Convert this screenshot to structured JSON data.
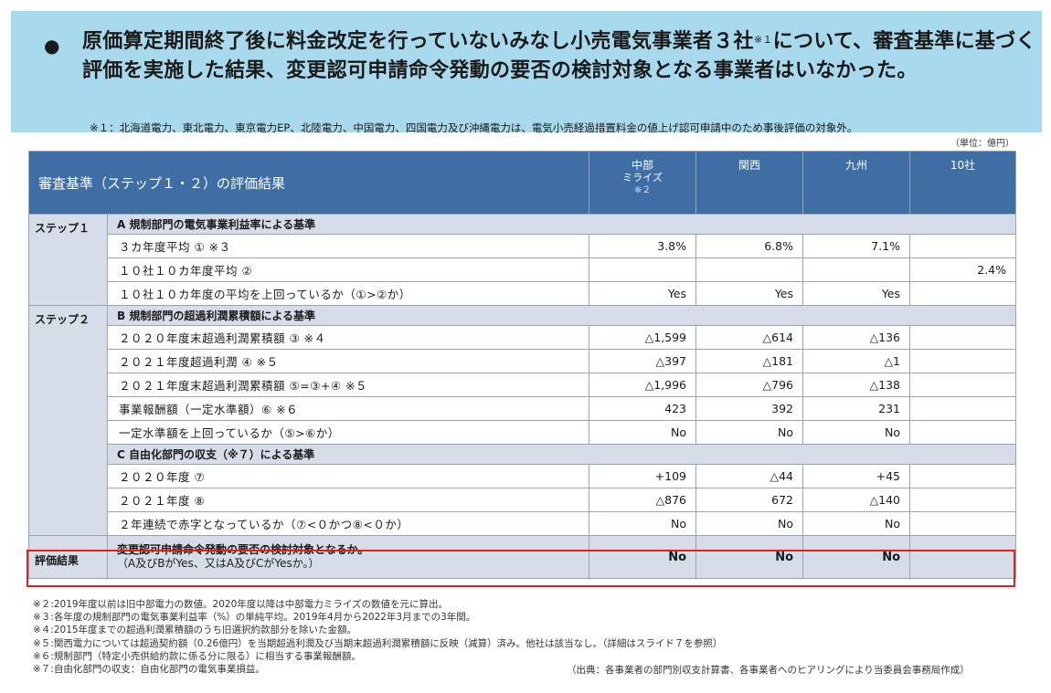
{
  "banner": {
    "bullet": "●",
    "headline_pre": "原価算定期間終了後に料金改定を行っていないみなし小売電気事業者３社",
    "headline_sup": "※１",
    "headline_post": "について、審査基準に基づく評価を実施した結果、変更認可申請命令発動の要否の検討対象となる事業者はいなかった。",
    "note": "※１：北海道電力、東北電力、東京電力EP、北陸電力、中国電力、四国電力及び沖縄電力は、電気小売経過措置料金の値上げ認可申請中のため事後評価の対象外。"
  },
  "unit": "（単位：億円）",
  "table": {
    "title": "審査基準（ステップ１・２）の評価結果",
    "columns": [
      {
        "name": "中部",
        "sub": "ミライズ",
        "note": "※２"
      },
      {
        "name": "関西",
        "sub": "",
        "note": ""
      },
      {
        "name": "九州",
        "sub": "",
        "note": ""
      },
      {
        "name": "10社",
        "sub": "",
        "note": ""
      }
    ],
    "step1_label": "ステップ１",
    "step2_label": "ステップ２",
    "secA": "A  規制部門の電気事業利益率による基準",
    "secB": "B  規制部門の超過利潤累積額による基準",
    "secC": "C  自由化部門の収支（※７）による基準",
    "rowsA": [
      {
        "label": "３カ年度平均 ①  ※３",
        "v": [
          "3.8%",
          "6.8%",
          "7.1%",
          ""
        ]
      },
      {
        "label": "１０社１０カ年度平均 ②",
        "v": [
          "",
          "",
          "",
          "2.4%"
        ]
      },
      {
        "label": "１０社１０カ年度の平均を上回っているか（①>②か）",
        "v": [
          "Yes",
          "Yes",
          "Yes",
          ""
        ]
      }
    ],
    "rowsB": [
      {
        "label": "２０２０年度末超過利潤累積額 ③  ※４",
        "v": [
          "△1,599",
          "△614",
          "△136",
          ""
        ]
      },
      {
        "label": "２０２１年度超過利潤 ④  ※５",
        "v": [
          "△397",
          "△181",
          "△1",
          ""
        ]
      },
      {
        "label": "２０２１年度末超過利潤累積額 ⑤=③+④  ※５",
        "v": [
          "△1,996",
          "△796",
          "△138",
          ""
        ]
      },
      {
        "label": "事業報酬額（一定水準額）⑥  ※６",
        "v": [
          "423",
          "392",
          "231",
          ""
        ]
      },
      {
        "label": "一定水準額を上回っているか（⑤>⑥か）",
        "v": [
          "No",
          "No",
          "No",
          ""
        ]
      }
    ],
    "rowsC": [
      {
        "label": "２０２０年度 ⑦",
        "v": [
          "+109",
          "△44",
          "+45",
          ""
        ]
      },
      {
        "label": "２０２１年度 ⑧",
        "v": [
          "△876",
          "672",
          "△140",
          ""
        ]
      },
      {
        "label": "２年連続で赤字となっているか（⑦<０かつ⑧<０か）",
        "v": [
          "No",
          "No",
          "No",
          ""
        ]
      }
    ],
    "result": {
      "label": "評価結果",
      "q1": "変更認可申請命令発動の要否の検討対象となるか。",
      "q2": "（A及びBがYes、又はA及びCがYesか。）",
      "v": [
        "No",
        "No",
        "No",
        ""
      ]
    }
  },
  "footnotes": [
    "※２:2019年度以前は旧中部電力の数値。2020年度以降は中部電力ミライズの数値を元に算出。",
    "※３:各年度の規制部門の電気事業利益率（%）の単純平均。2019年4月から2022年3月までの3年間。",
    "※４:2015年度までの超過利潤累積額のうち旧選択約款部分を除いた金額。",
    "※５:関西電力については超過契約額（0.26億円）を当期超過利潤及び当期末超過利潤累積額に反映（減算）済み。他社は該当なし。（詳細はスライド７を参照）",
    "※６:規制部門（特定小売供給約款に係る分に限る）に相当する事業報酬額。",
    "※７:自由化部門の収支：自由化部門の電気事業損益。"
  ],
  "source": "（出典：各事業者の部門別収支計算書、各事業者へのヒアリングにより当委員会事務局作成）"
}
